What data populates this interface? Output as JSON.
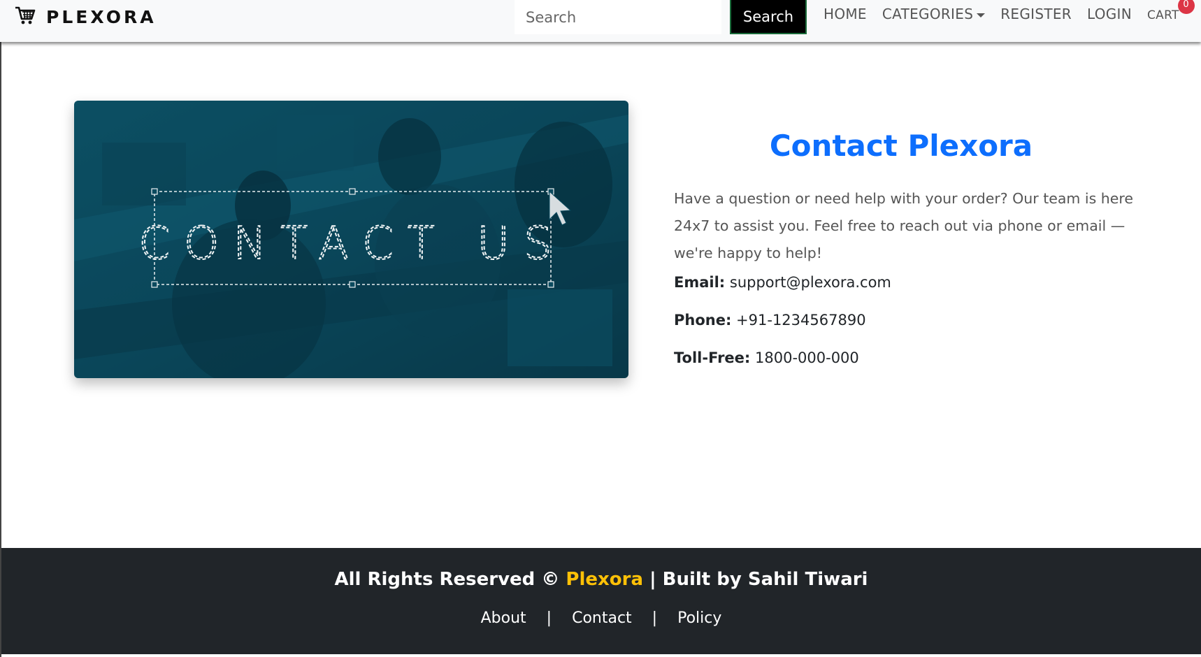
{
  "navbar": {
    "brand": "PLEXORA",
    "search_placeholder": "Search",
    "search_button": "Search",
    "links": {
      "home": "HOME",
      "categories": "CATEGORIES",
      "register": "REGISTER",
      "login": "LOGIN",
      "cart": "CART"
    },
    "cart_count": "0"
  },
  "image": {
    "overlay_text": "CONTACT US"
  },
  "contact": {
    "title": "Contact Plexora",
    "description": "Have a question or need help with your order? Our team is here 24x7 to assist you. Feel free to reach out via phone or email — we're happy to help!",
    "email_label": "Email:",
    "email_value": "support@plexora.com",
    "phone_label": "Phone:",
    "phone_value": "+91-1234567890",
    "tollfree_label": "Toll-Free:",
    "tollfree_value": "1800-000-000"
  },
  "footer": {
    "rights_prefix": "All Rights Reserved ©",
    "brand": "Plexora",
    "rights_suffix": "| Built by Sahil Tiwari",
    "links": {
      "about": "About",
      "contact": "Contact",
      "policy": "Policy"
    },
    "separator": "|"
  },
  "colors": {
    "accent_blue": "#0d6efd",
    "footer_bg": "#212529",
    "footer_brand": "#ffc107",
    "image_teal": "#0b4a5e",
    "badge_red": "#dc3545"
  }
}
